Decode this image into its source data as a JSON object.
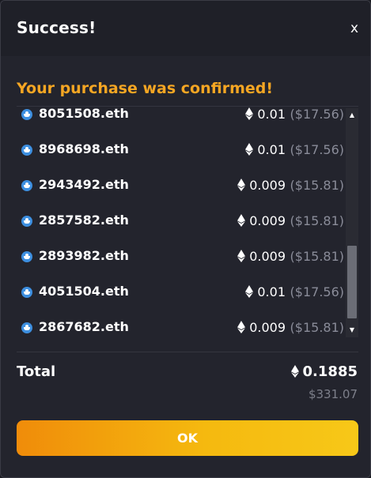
{
  "dialog": {
    "title": "Success!",
    "close_label": "x",
    "confirmation_message": "Your purchase was confirmed!"
  },
  "items": [
    {
      "domain": "8051508.eth",
      "price_eth": "0.01",
      "price_usd": "($17.56)"
    },
    {
      "domain": "8968698.eth",
      "price_eth": "0.01",
      "price_usd": "($17.56)"
    },
    {
      "domain": "2943492.eth",
      "price_eth": "0.009",
      "price_usd": "($15.81)"
    },
    {
      "domain": "2857582.eth",
      "price_eth": "0.009",
      "price_usd": "($15.81)"
    },
    {
      "domain": "2893982.eth",
      "price_eth": "0.009",
      "price_usd": "($15.81)"
    },
    {
      "domain": "4051504.eth",
      "price_eth": "0.01",
      "price_usd": "($17.56)"
    },
    {
      "domain": "2867682.eth",
      "price_eth": "0.009",
      "price_usd": "($15.81)"
    }
  ],
  "total": {
    "label": "Total",
    "eth": "0.1885",
    "usd": "$331.07"
  },
  "ok_button_label": "OK",
  "scrollbar": {
    "up_icon": "▲",
    "down_icon": "▼"
  },
  "colors": {
    "accent": "#f5a623",
    "background": "#23242d",
    "ens_icon": "#3d8fe0",
    "muted_text": "#8a8c99"
  },
  "icons": {
    "item_icon": "ens-logo-icon",
    "currency_icon": "ethereum-icon"
  }
}
